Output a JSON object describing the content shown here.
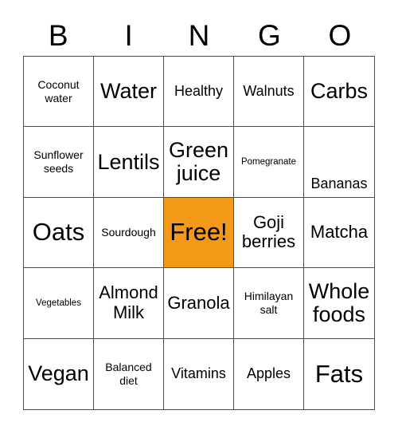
{
  "card": {
    "header_letters": [
      "B",
      "I",
      "N",
      "G",
      "O"
    ],
    "free_space_color": "#f59a18",
    "border_color": "#4d4d4d",
    "background_color": "#ffffff",
    "rows": 5,
    "columns": 5,
    "cells": [
      {
        "label": "Coconut water",
        "size": "s",
        "free": false,
        "align": "center"
      },
      {
        "label": "Water",
        "size": "xl",
        "free": false,
        "align": "center"
      },
      {
        "label": "Healthy",
        "size": "m",
        "free": false,
        "align": "center"
      },
      {
        "label": "Walnuts",
        "size": "m",
        "free": false,
        "align": "center"
      },
      {
        "label": "Carbs",
        "size": "xl",
        "free": false,
        "align": "center"
      },
      {
        "label": "Sunflower seeds",
        "size": "s",
        "free": false,
        "align": "center"
      },
      {
        "label": "Lentils",
        "size": "xl",
        "free": false,
        "align": "center"
      },
      {
        "label": "Green juice",
        "size": "xl",
        "free": false,
        "align": "center"
      },
      {
        "label": "Pomegranate",
        "size": "xs",
        "free": false,
        "align": "center"
      },
      {
        "label": "Bananas",
        "size": "m",
        "free": false,
        "align": "bottom"
      },
      {
        "label": "Oats",
        "size": "xxl",
        "free": false,
        "align": "center"
      },
      {
        "label": "Sourdough",
        "size": "s",
        "free": false,
        "align": "center"
      },
      {
        "label": "Free!",
        "size": "xxl",
        "free": true,
        "align": "center"
      },
      {
        "label": "Goji berries",
        "size": "l",
        "free": false,
        "align": "center"
      },
      {
        "label": "Matcha",
        "size": "l",
        "free": false,
        "align": "center"
      },
      {
        "label": "Vegetables",
        "size": "xs",
        "free": false,
        "align": "center"
      },
      {
        "label": "Almond Milk",
        "size": "l",
        "free": false,
        "align": "center"
      },
      {
        "label": "Granola",
        "size": "l",
        "free": false,
        "align": "center"
      },
      {
        "label": "Himilayan salt",
        "size": "s",
        "free": false,
        "align": "center"
      },
      {
        "label": "Whole foods",
        "size": "xl",
        "free": false,
        "align": "center"
      },
      {
        "label": "Vegan",
        "size": "xl",
        "free": false,
        "align": "center"
      },
      {
        "label": "Balanced diet",
        "size": "s",
        "free": false,
        "align": "center"
      },
      {
        "label": "Vitamins",
        "size": "m",
        "free": false,
        "align": "center"
      },
      {
        "label": "Apples",
        "size": "m",
        "free": false,
        "align": "center"
      },
      {
        "label": "Fats",
        "size": "xxl",
        "free": false,
        "align": "center"
      }
    ]
  }
}
